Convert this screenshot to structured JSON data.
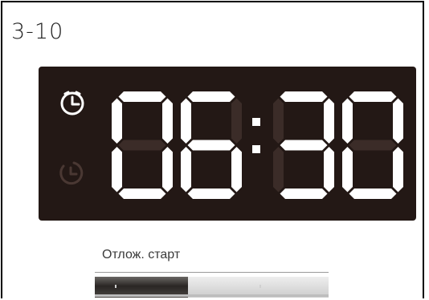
{
  "figure_label": "3-10",
  "display": {
    "time_digits": [
      "0",
      "6",
      "3",
      "0"
    ],
    "indicators": [
      {
        "icon": "timer-clock-icon",
        "active": true
      },
      {
        "icon": "delay-timer-icon",
        "active": false
      }
    ]
  },
  "panel": {
    "label": "Отлож. старт",
    "slider_fraction": 0.4
  },
  "colors": {
    "display_bg": "#231815",
    "segment_on": "#ffffff",
    "segment_off": "#3b2c28"
  }
}
